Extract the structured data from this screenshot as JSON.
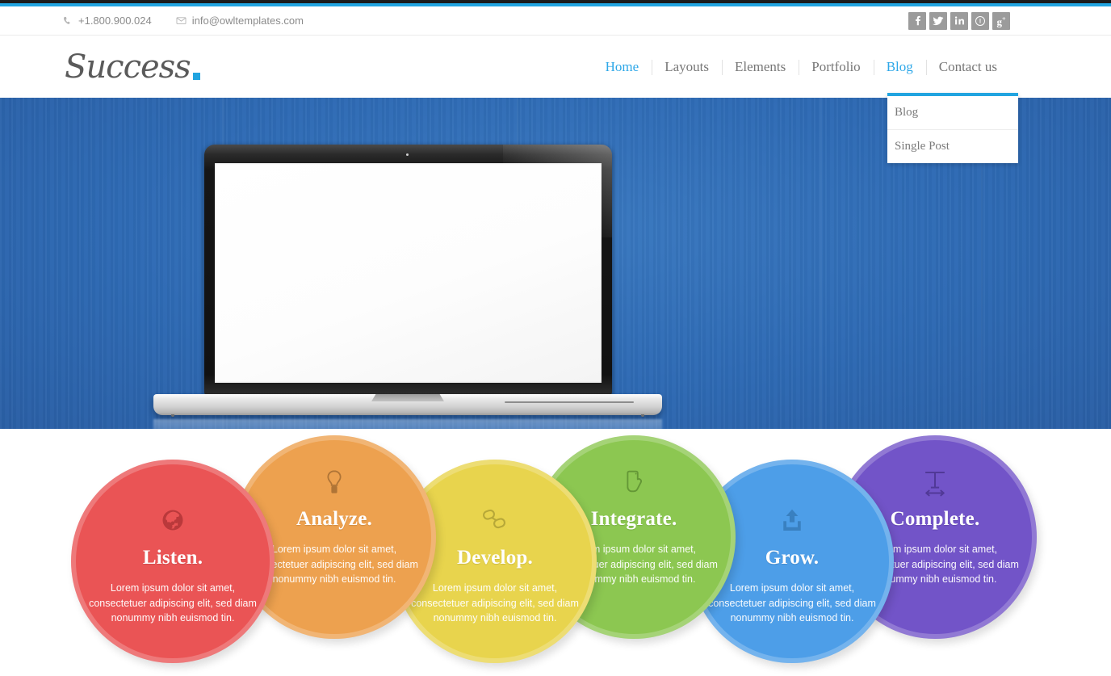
{
  "topbar": {
    "phone": "+1.800.900.024",
    "phone_icon": "phone-icon",
    "email": "info@owltemplates.com",
    "email_icon": "envelope-icon",
    "social": [
      {
        "name": "facebook",
        "label": "f"
      },
      {
        "name": "twitter",
        "label": "t"
      },
      {
        "name": "linkedin",
        "label": "in"
      },
      {
        "name": "pinterest",
        "label": "p"
      },
      {
        "name": "googleplus",
        "label": "g+"
      }
    ]
  },
  "header": {
    "logo_text": "Success",
    "logo_accent_color": "#21a4e0",
    "nav": [
      {
        "label": "Home",
        "active": true
      },
      {
        "label": "Layouts",
        "active": false
      },
      {
        "label": "Elements",
        "active": false
      },
      {
        "label": "Portfolio",
        "active": false
      },
      {
        "label": "Blog",
        "active": true
      },
      {
        "label": "Contact us",
        "active": false
      }
    ],
    "dropdown": {
      "parent": "Blog",
      "accent_color": "#21a4e0",
      "items": [
        {
          "label": "Blog"
        },
        {
          "label": "Single Post"
        }
      ]
    }
  },
  "hero": {
    "background_color": "#2e6ab4",
    "device": "macbook-laptop",
    "screen_content": ""
  },
  "features": {
    "body_text": "Lorem ipsum dolor sit amet, consectetuer adipiscing elit, sed diam nonummy nibh euismod tin.",
    "items": [
      {
        "title": "Listen.",
        "icon": "globe-icon",
        "color": "#ea5455",
        "position": "low"
      },
      {
        "title": "Analyze.",
        "icon": "lightbulb-icon",
        "color": "#eda14f",
        "position": "high"
      },
      {
        "title": "Develop.",
        "icon": "link-icon",
        "color": "#e8d44d",
        "position": "low"
      },
      {
        "title": "Integrate.",
        "icon": "hand-icon",
        "color": "#8cc751",
        "position": "high"
      },
      {
        "title": "Grow.",
        "icon": "upload-icon",
        "color": "#4d9ee8",
        "position": "low"
      },
      {
        "title": "Complete.",
        "icon": "text-width-icon",
        "color": "#7254c8",
        "position": "high"
      }
    ]
  }
}
